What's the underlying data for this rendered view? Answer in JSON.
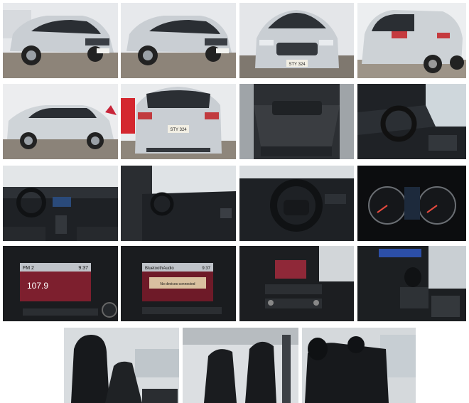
{
  "gallery": {
    "plate_text": "STY 324",
    "radio": {
      "band": "FM 2",
      "frequency": "107.9",
      "time": "9:37"
    },
    "bluetooth": {
      "title": "BluetoothAudio",
      "time": "9:37",
      "message": "No devices connected"
    }
  },
  "colors": {
    "car_body": "#c9ced3",
    "floor": "#8a8278",
    "interior_dark": "#1d1f22",
    "screen_red": "#b2283a",
    "screen_blue": "#2c4fa8"
  }
}
